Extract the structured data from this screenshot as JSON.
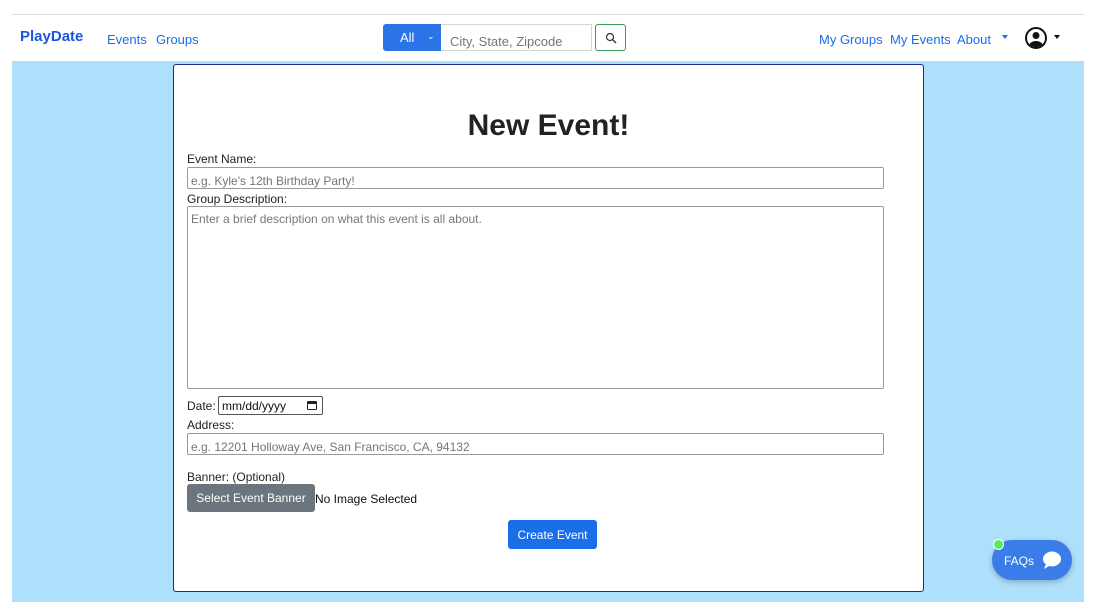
{
  "navbar": {
    "brand": "PlayDate",
    "links": [
      "Events",
      "Groups"
    ],
    "search": {
      "category": "All",
      "placeholder": "City, State, Zipcode"
    },
    "right_links": [
      "My Groups",
      "My Events",
      "About"
    ]
  },
  "form": {
    "title": "New Event!",
    "event_name_label": "Event Name:",
    "event_name_placeholder": "e.g. Kyle's 12th Birthday Party!",
    "description_label": "Group Description:",
    "description_placeholder": "Enter a brief description on what this event is all about.",
    "date_label": "Date:",
    "date_value": "mm/dd/yyyy",
    "address_label": "Address:",
    "address_placeholder": "e.g. 12201 Holloway Ave, San Francisco, CA, 94132",
    "banner_label": "Banner: (Optional)",
    "banner_button": "Select Event Banner",
    "banner_status": "No Image Selected",
    "submit_button": "Create Event"
  },
  "faq": {
    "label": "FAQs"
  },
  "colors": {
    "accent": "#1a6ee8",
    "background": "#aee0fc",
    "secondary": "#6c757d"
  }
}
